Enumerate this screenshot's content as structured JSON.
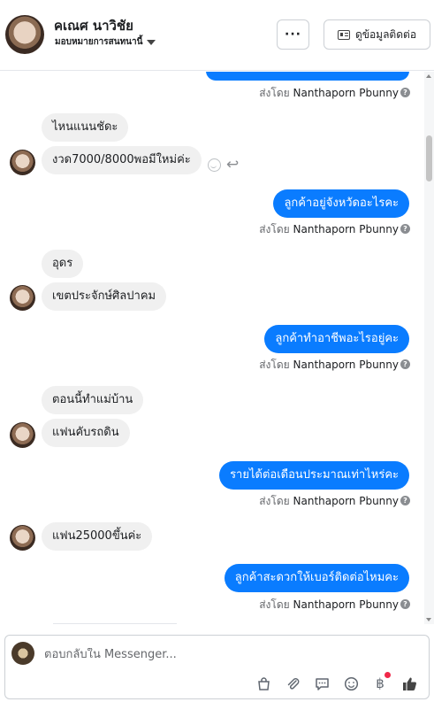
{
  "header": {
    "contact_name": "คเณศ นาวิชัย",
    "assign_label": "มอบหมายการสนทนานี้",
    "more_label": "···",
    "contact_info_label": "ดูข้อมูลติดต่อ"
  },
  "thread": {
    "sent_by_prefix": "ส่งโดย",
    "sender_name": "Nanthaporn Pbunny",
    "messages": [
      {
        "dir": "out",
        "text": "",
        "partial": true
      },
      {
        "dir": "in",
        "text": "ไหนแนนชัดะ"
      },
      {
        "dir": "in",
        "text": "งวด7000/8000พอมีใหม่ค่ะ"
      },
      {
        "dir": "out",
        "text": "ลูกค้าอยู่จังหวัดอะไรคะ"
      },
      {
        "dir": "in",
        "text": "อุดร"
      },
      {
        "dir": "in",
        "text": "เขตประจักษ์ศิลปาคม"
      },
      {
        "dir": "out",
        "text": "ลูกค้าทำอาชีพอะไรอยู่คะ"
      },
      {
        "dir": "in",
        "text": "ตอนนี้ทำแม่บ้าน"
      },
      {
        "dir": "in",
        "text": "แฟนคับรถดิน"
      },
      {
        "dir": "out",
        "text": "รายได้ต่อเดือนประมาณเท่าไหร่คะ"
      },
      {
        "dir": "in",
        "text": "แฟน25000ขึ้นค่ะ"
      },
      {
        "dir": "out",
        "text": "ลูกค้าสะดวกให้เบอร์ติดต่อไหมคะ"
      }
    ]
  },
  "composer": {
    "placeholder": "ตอบกลับใน Messenger..."
  },
  "icons": {
    "tools": [
      "shopping-bag-icon",
      "paperclip-icon",
      "speech-bubble-icon",
      "emoji-icon",
      "baht-icon",
      "thumbs-up-icon"
    ]
  },
  "colors": {
    "outgoing_bubble": "#0a7cff",
    "incoming_bubble": "#f0f0f0",
    "notification_dot": "#f02849"
  }
}
